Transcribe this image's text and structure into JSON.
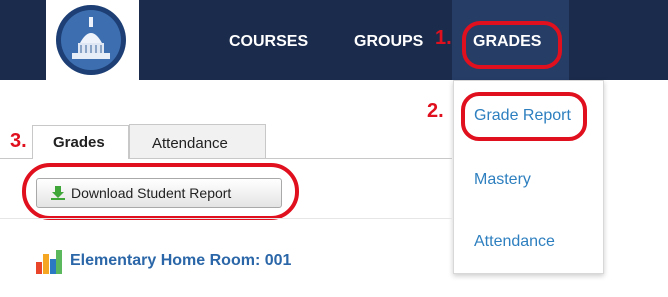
{
  "nav": {
    "courses": "COURSES",
    "groups": "GROUPS",
    "grades": "GRADES"
  },
  "dropdown": {
    "items": [
      "Grade Report",
      "Mastery",
      "Attendance"
    ]
  },
  "tabs": [
    "Grades",
    "Attendance"
  ],
  "download_button": "Download Student Report",
  "room_title": "Elementary Home Room: 001",
  "annotations": [
    "1.",
    "2.",
    "3."
  ],
  "colors": {
    "header": "#1b2b4b",
    "annotation": "#e0101e",
    "link": "#2d7fbf"
  },
  "icons": {
    "logo": "capitol-dome-logo",
    "download": "download-arrow-icon",
    "room": "bar-chart-icon"
  }
}
